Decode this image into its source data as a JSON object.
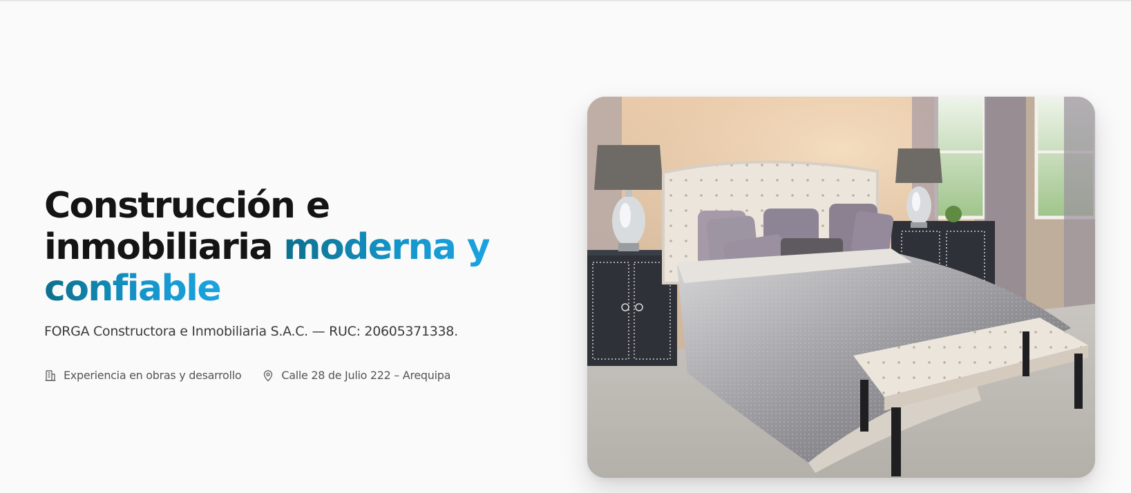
{
  "hero": {
    "title_line1": "Construcción e",
    "title_line2_plain": "inmobiliaria ",
    "title_line2_accent": "moderna y",
    "title_line3_accent": "confiable",
    "subtitle": "FORGA Constructora e Inmobiliaria S.A.C. — RUC: 20605371338.",
    "features": [
      {
        "icon": "building-icon",
        "label": "Experiencia en obras y desarrollo"
      },
      {
        "icon": "location-pin-icon",
        "label": "Calle 28 de Julio 222 – Arequipa"
      }
    ],
    "accent_color_start": "#0e6f8c",
    "accent_color_end": "#1aa3e0"
  },
  "image": {
    "subject": "bedroom-photo"
  }
}
